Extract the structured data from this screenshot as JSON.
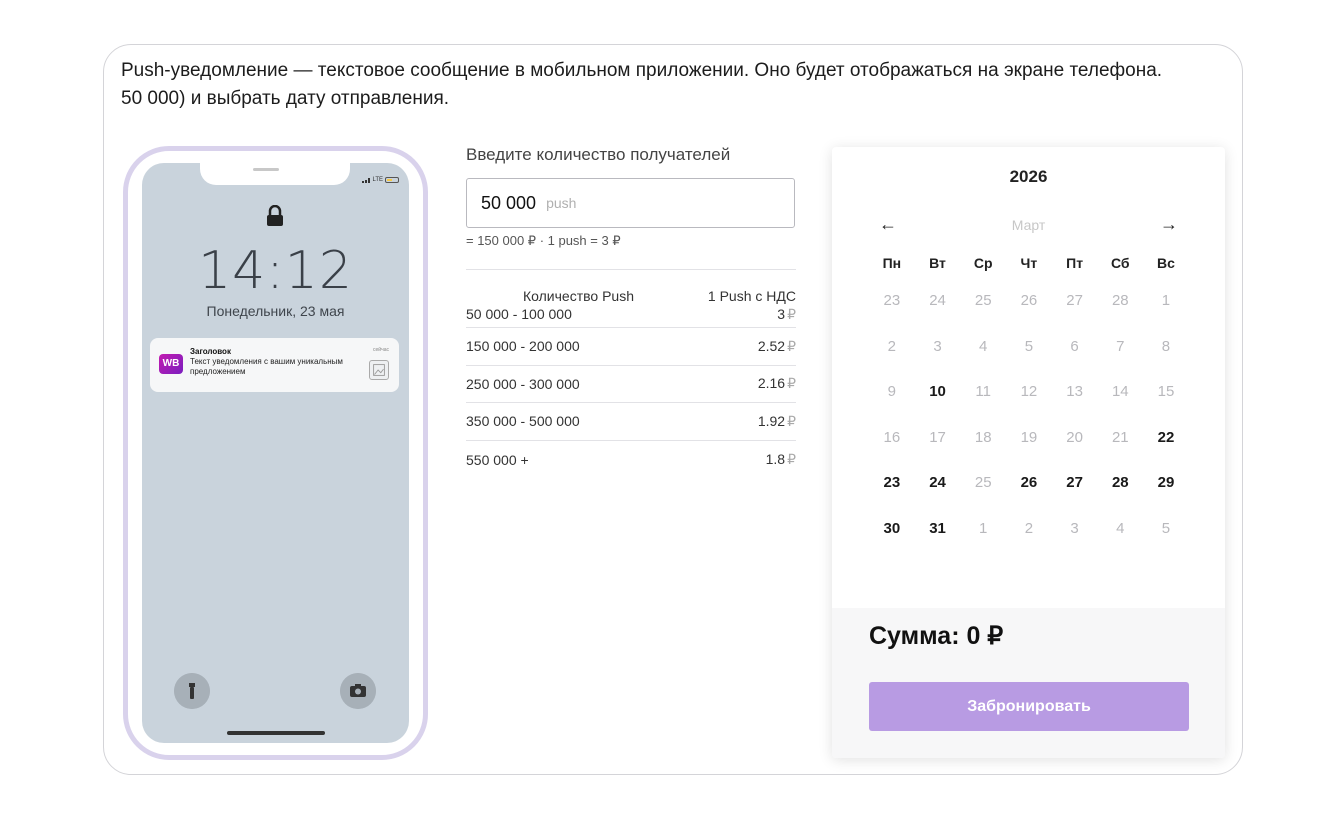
{
  "intro": {
    "line1": "Push-уведомление — текстовое сообщение в мобильном приложении. Оно будет отображаться на экране телефона.",
    "line2": "50 000) и выбрать дату отправления."
  },
  "phone": {
    "status": "LTE",
    "time": "14:12",
    "date": "Понедельник, 23 мая",
    "notification": {
      "app_icon": "WB",
      "title": "Заголовок",
      "text": "Текст уведомления с вашим уникальным предложением",
      "when": "сейчас"
    },
    "icons": [
      "lock-icon",
      "flashlight-icon",
      "camera-icon"
    ]
  },
  "recipients": {
    "label": "Введите количество получателей",
    "value": "50 000",
    "unit": "push",
    "calc": "= 150 000 ₽  ·  1 push = 3 ₽"
  },
  "pricing": {
    "headers": [
      "Количество Push",
      "1 Push с НДС"
    ],
    "currency": "₽",
    "rows": [
      {
        "range": "50 000 - 100 000",
        "price": "3"
      },
      {
        "range": "150 000 - 200 000",
        "price": "2.52"
      },
      {
        "range": "250 000 - 300 000",
        "price": "2.16"
      },
      {
        "range": "350 000 - 500 000",
        "price": "1.92"
      },
      {
        "range": "550 000 +",
        "price": "1.8"
      }
    ]
  },
  "calendar": {
    "year": "2026",
    "month": "Март",
    "prev": "←",
    "next": "→",
    "weekdays": [
      "Пн",
      "Вт",
      "Ср",
      "Чт",
      "Пт",
      "Сб",
      "Вс"
    ],
    "days": [
      {
        "d": "23",
        "s": "off"
      },
      {
        "d": "24",
        "s": "off"
      },
      {
        "d": "25",
        "s": "off"
      },
      {
        "d": "26",
        "s": "off"
      },
      {
        "d": "27",
        "s": "off"
      },
      {
        "d": "28",
        "s": "off"
      },
      {
        "d": "1",
        "s": "dis"
      },
      {
        "d": "2",
        "s": "dis"
      },
      {
        "d": "3",
        "s": "dis"
      },
      {
        "d": "4",
        "s": "dis"
      },
      {
        "d": "5",
        "s": "dis"
      },
      {
        "d": "6",
        "s": "dis"
      },
      {
        "d": "7",
        "s": "dis"
      },
      {
        "d": "8",
        "s": "dis"
      },
      {
        "d": "9",
        "s": "dis"
      },
      {
        "d": "10",
        "s": "on"
      },
      {
        "d": "11",
        "s": "dis"
      },
      {
        "d": "12",
        "s": "dis"
      },
      {
        "d": "13",
        "s": "dis"
      },
      {
        "d": "14",
        "s": "dis"
      },
      {
        "d": "15",
        "s": "dis"
      },
      {
        "d": "16",
        "s": "dis"
      },
      {
        "d": "17",
        "s": "dis"
      },
      {
        "d": "18",
        "s": "dis"
      },
      {
        "d": "19",
        "s": "dis"
      },
      {
        "d": "20",
        "s": "dis"
      },
      {
        "d": "21",
        "s": "dis"
      },
      {
        "d": "22",
        "s": "on"
      },
      {
        "d": "23",
        "s": "on"
      },
      {
        "d": "24",
        "s": "on"
      },
      {
        "d": "25",
        "s": "dis"
      },
      {
        "d": "26",
        "s": "on"
      },
      {
        "d": "27",
        "s": "on"
      },
      {
        "d": "28",
        "s": "on"
      },
      {
        "d": "29",
        "s": "on"
      },
      {
        "d": "30",
        "s": "on"
      },
      {
        "d": "31",
        "s": "on"
      },
      {
        "d": "1",
        "s": "off"
      },
      {
        "d": "2",
        "s": "off"
      },
      {
        "d": "3",
        "s": "off"
      },
      {
        "d": "4",
        "s": "off"
      },
      {
        "d": "5",
        "s": "off"
      }
    ],
    "sum": "Сумма: 0 ₽",
    "book_label": "Забронировать"
  },
  "colors": {
    "accent": "#b89be3",
    "phone_frame": "#d9d2ec",
    "screen": "#c9d3dc"
  }
}
